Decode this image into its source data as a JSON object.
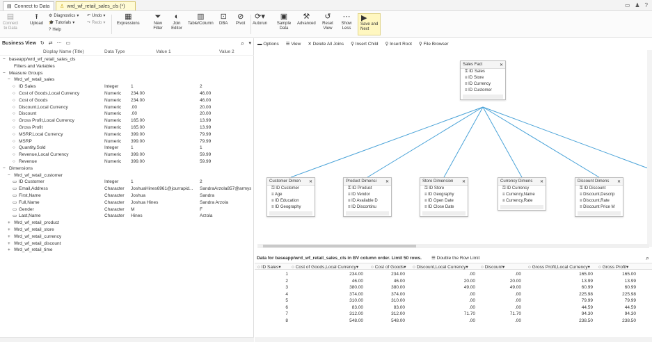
{
  "tabs": [
    {
      "label": "Connect to Data",
      "icon": "db-icon",
      "active": false
    },
    {
      "label": "wrd_wf_retail_sales_cls (*)",
      "icon": "user-icon",
      "active": true
    }
  ],
  "toolbar": {
    "connect": "Connect to Data",
    "upload": "Upload",
    "diagnostics": "Diagnostics",
    "tutorials": "Tutorials",
    "help": "Help",
    "undo": "Undo",
    "redo": "Redo",
    "expressions": "Expressions",
    "new_filter": "New Filter",
    "join_editor": "Join Editor",
    "table_column": "Table/Column",
    "dba": "DBA",
    "pivot": "Pivot",
    "autorun": "Autorun",
    "sample_data": "Sample Data",
    "advanced": "Advanced",
    "reset_view": "Reset View",
    "show_less": "Show Less",
    "save_next": "Save and Next"
  },
  "left": {
    "title": "Business View",
    "columns": [
      "Display Name (Title)",
      "Data Type",
      "Value 1",
      "Value 2"
    ],
    "rows": [
      {
        "indent": 0,
        "prefix": "−",
        "name": "baseapp/wrd_wf_retail_sales_cls",
        "type": "",
        "v1": "",
        "v2": ""
      },
      {
        "indent": 1,
        "prefix": "",
        "name": "Filters and Variables",
        "type": "",
        "v1": "",
        "v2": ""
      },
      {
        "indent": 0,
        "prefix": "−",
        "name": "Measure Groups",
        "type": "",
        "v1": "",
        "v2": ""
      },
      {
        "indent": 1,
        "prefix": "−",
        "name": "Wrd_wf_retail_sales",
        "type": "",
        "v1": "",
        "v2": ""
      },
      {
        "indent": 2,
        "prefix": "○",
        "name": "ID Sales",
        "type": "Integer",
        "v1": "1",
        "v2": "2"
      },
      {
        "indent": 2,
        "prefix": "○",
        "name": "Cost of Goods,Local Currency",
        "type": "Numeric",
        "v1": "234.00",
        "v2": "46.00"
      },
      {
        "indent": 2,
        "prefix": "○",
        "name": "Cost of Goods",
        "type": "Numeric",
        "v1": "234.00",
        "v2": "46.00"
      },
      {
        "indent": 2,
        "prefix": "○",
        "name": "Discount,Local Currency",
        "type": "Numeric",
        "v1": ".00",
        "v2": "20.00"
      },
      {
        "indent": 2,
        "prefix": "○",
        "name": "Discount",
        "type": "Numeric",
        "v1": ".00",
        "v2": "20.00"
      },
      {
        "indent": 2,
        "prefix": "○",
        "name": "Gross Profit,Local Currency",
        "type": "Numeric",
        "v1": "165.00",
        "v2": "13.99"
      },
      {
        "indent": 2,
        "prefix": "○",
        "name": "Gross Profit",
        "type": "Numeric",
        "v1": "165.00",
        "v2": "13.99"
      },
      {
        "indent": 2,
        "prefix": "○",
        "name": "MSRP,Local Currency",
        "type": "Numeric",
        "v1": "399.00",
        "v2": "79.99"
      },
      {
        "indent": 2,
        "prefix": "○",
        "name": "MSRP",
        "type": "Numeric",
        "v1": "399.00",
        "v2": "79.99"
      },
      {
        "indent": 2,
        "prefix": "○",
        "name": "Quantity,Sold",
        "type": "Integer",
        "v1": "1",
        "v2": "1"
      },
      {
        "indent": 2,
        "prefix": "○",
        "name": "Revenue,Local Currency",
        "type": "Numeric",
        "v1": "399.00",
        "v2": "59.99"
      },
      {
        "indent": 2,
        "prefix": "○",
        "name": "Revenue",
        "type": "Numeric",
        "v1": "399.00",
        "v2": "59.99"
      },
      {
        "indent": 0,
        "prefix": "−",
        "name": "Dimensions",
        "type": "",
        "v1": "",
        "v2": ""
      },
      {
        "indent": 1,
        "prefix": "−",
        "name": "Wrd_wf_retail_customer",
        "type": "",
        "v1": "",
        "v2": ""
      },
      {
        "indent": 2,
        "prefix": "▭",
        "name": "ID Customer",
        "type": "Integer",
        "v1": "1",
        "v2": "2"
      },
      {
        "indent": 2,
        "prefix": "▭",
        "name": "Email,Address",
        "type": "Character",
        "v1": "JoshuaHines6961@jourrapid...",
        "v2": "SandraArzola857@armysp"
      },
      {
        "indent": 2,
        "prefix": "▭",
        "name": "First,Name",
        "type": "Character",
        "v1": "Joshua",
        "v2": "Sandra"
      },
      {
        "indent": 2,
        "prefix": "▭",
        "name": "Full,Name",
        "type": "Character",
        "v1": "Joshua Hines",
        "v2": "Sandra Arzola"
      },
      {
        "indent": 2,
        "prefix": "▭",
        "name": "Gender",
        "type": "Character",
        "v1": "M",
        "v2": "F"
      },
      {
        "indent": 2,
        "prefix": "▭",
        "name": "Last,Name",
        "type": "Character",
        "v1": "Hines",
        "v2": "Arzola"
      },
      {
        "indent": 1,
        "prefix": "+",
        "name": "Wrd_wf_retail_product",
        "type": "",
        "v1": "",
        "v2": ""
      },
      {
        "indent": 1,
        "prefix": "+",
        "name": "Wrd_wf_retail_store",
        "type": "",
        "v1": "",
        "v2": ""
      },
      {
        "indent": 1,
        "prefix": "+",
        "name": "Wrd_wf_retail_currency",
        "type": "",
        "v1": "",
        "v2": ""
      },
      {
        "indent": 1,
        "prefix": "+",
        "name": "Wrd_wf_retail_discount",
        "type": "",
        "v1": "",
        "v2": ""
      },
      {
        "indent": 1,
        "prefix": "+",
        "name": "Wrd_wf_retail_time",
        "type": "",
        "v1": "",
        "v2": ""
      }
    ]
  },
  "right": {
    "toolbar": [
      "Options",
      "View",
      "Delete All Joins",
      "Insert Child",
      "Insert Root",
      "File Browser"
    ],
    "fact": {
      "title": "Sales Fact",
      "items": [
        "ID Sales",
        "ID Store",
        "ID Currency",
        "ID Customer"
      ]
    },
    "dims": [
      {
        "title": "Customer Dimen",
        "items": [
          "ID Customer",
          "Age",
          "ID Education",
          "ID Geography"
        ]
      },
      {
        "title": "Product Dimensi",
        "items": [
          "ID Product",
          "ID Vendor",
          "ID Available D",
          "ID Discontinu"
        ]
      },
      {
        "title": "Store Dimension",
        "items": [
          "ID Store",
          "ID Geography",
          "ID Open Date",
          "ID Close Date"
        ]
      },
      {
        "title": "Currency Dimens",
        "items": [
          "ID Currency",
          "Currency,Name",
          "Currency,Rate"
        ]
      },
      {
        "title": "Discount Dimens",
        "items": [
          "ID Discount",
          "Discount,Descrip",
          "Discount,Rate",
          "Discount Price M"
        ]
      }
    ],
    "data_title": "Data for baseapp/wrd_wf_retail_sales_cls in BV column order. Limit 50 rows.",
    "double_rows": "Double the Row Limit",
    "grid_columns": [
      "ID Sales",
      "Cost of Goods,Local Currency",
      "Cost of Goods",
      "Discount,Local Currency",
      "Discount",
      "Gross Profit,Local Currency",
      "Gross Profit"
    ],
    "grid_rows": [
      [
        "1",
        "234.00",
        "234.00",
        ".00",
        ".00",
        "165.00",
        "165.00"
      ],
      [
        "2",
        "46.00",
        "46.00",
        "20.00",
        "20.00",
        "13.99",
        "13.99"
      ],
      [
        "3",
        "380.00",
        "380.00",
        "49.00",
        "49.00",
        "60.99",
        "60.99"
      ],
      [
        "4",
        "374.00",
        "374.00",
        ".00",
        ".00",
        "225.98",
        "225.98"
      ],
      [
        "5",
        "310.00",
        "310.00",
        ".00",
        ".00",
        "79.99",
        "79.99"
      ],
      [
        "6",
        "83.00",
        "83.00",
        ".00",
        ".00",
        "44.59",
        "44.59"
      ],
      [
        "7",
        "312.00",
        "312.00",
        "71.70",
        "71.70",
        "94.30",
        "94.30"
      ],
      [
        "8",
        "548.00",
        "548.00",
        ".00",
        ".00",
        "238.50",
        "238.50"
      ]
    ]
  }
}
